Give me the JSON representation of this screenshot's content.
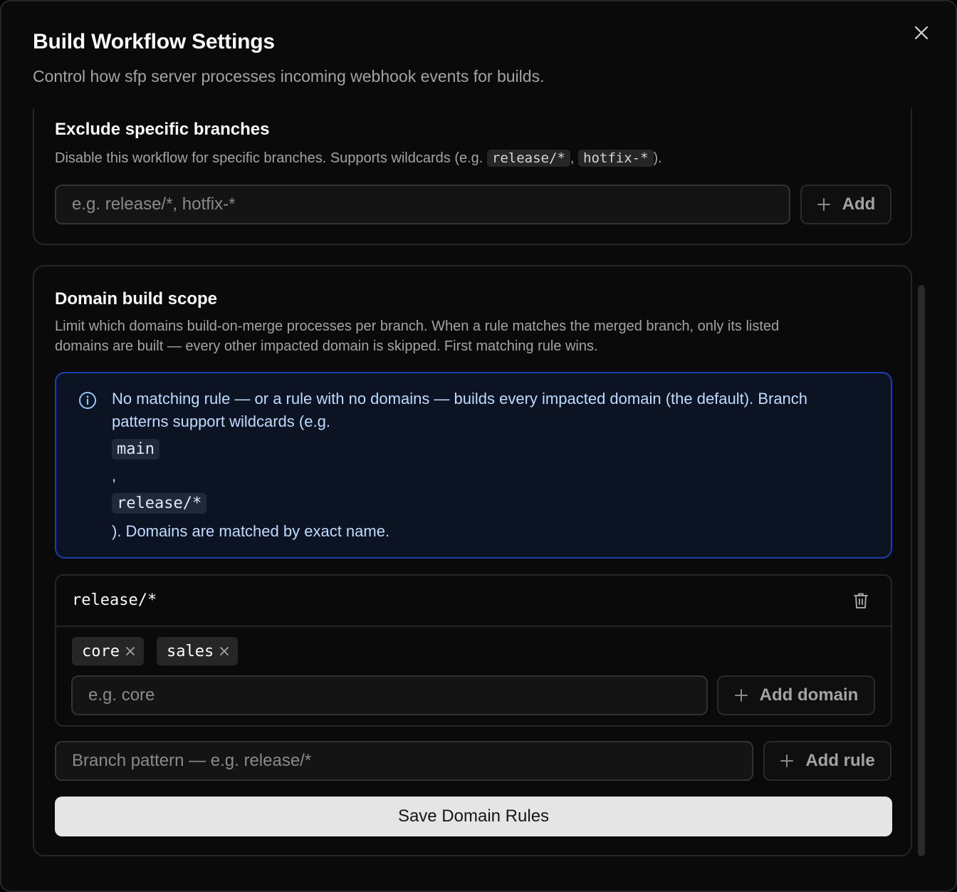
{
  "dialog": {
    "title": "Build Workflow Settings",
    "description": "Control how sfp server processes incoming webhook events for builds."
  },
  "exclude_branches": {
    "title": "Exclude specific branches",
    "description_prefix": "Disable this workflow for specific branches. Supports wildcards (e.g. ",
    "example_1": "release/*",
    "separator": ", ",
    "example_2": "hotfix-*",
    "description_suffix": ").",
    "input_placeholder": "e.g. release/*, hotfix-*",
    "add_label": "Add"
  },
  "domain_scope": {
    "title": "Domain build scope",
    "description_line_1": "Limit which domains build-on-merge processes per branch. When a rule matches the merged branch, only its listed",
    "description_line_2": "domains are built — every other impacted domain is skipped. First matching rule wins.",
    "info": {
      "line_1": "No matching rule — or a rule with no domains — builds every impacted domain (the default). Branch",
      "line_2": "patterns support wildcards (e.g.",
      "code_1": "main",
      "comma": ",",
      "code_2": "release/*",
      "line_end": "). Domains are matched by exact name."
    },
    "rules": [
      {
        "pattern": "release/*",
        "domains": [
          "core",
          "sales"
        ],
        "domain_input_placeholder": "e.g. core",
        "add_domain_label": "Add domain"
      }
    ],
    "branch_input_placeholder": "Branch pattern — e.g. release/*",
    "add_rule_label": "Add rule",
    "save_label": "Save Domain Rules"
  },
  "icons": {
    "close": "close-icon",
    "info": "info-icon",
    "trash": "trash-icon",
    "plus": "plus-icon",
    "chip_remove": "x-icon"
  }
}
